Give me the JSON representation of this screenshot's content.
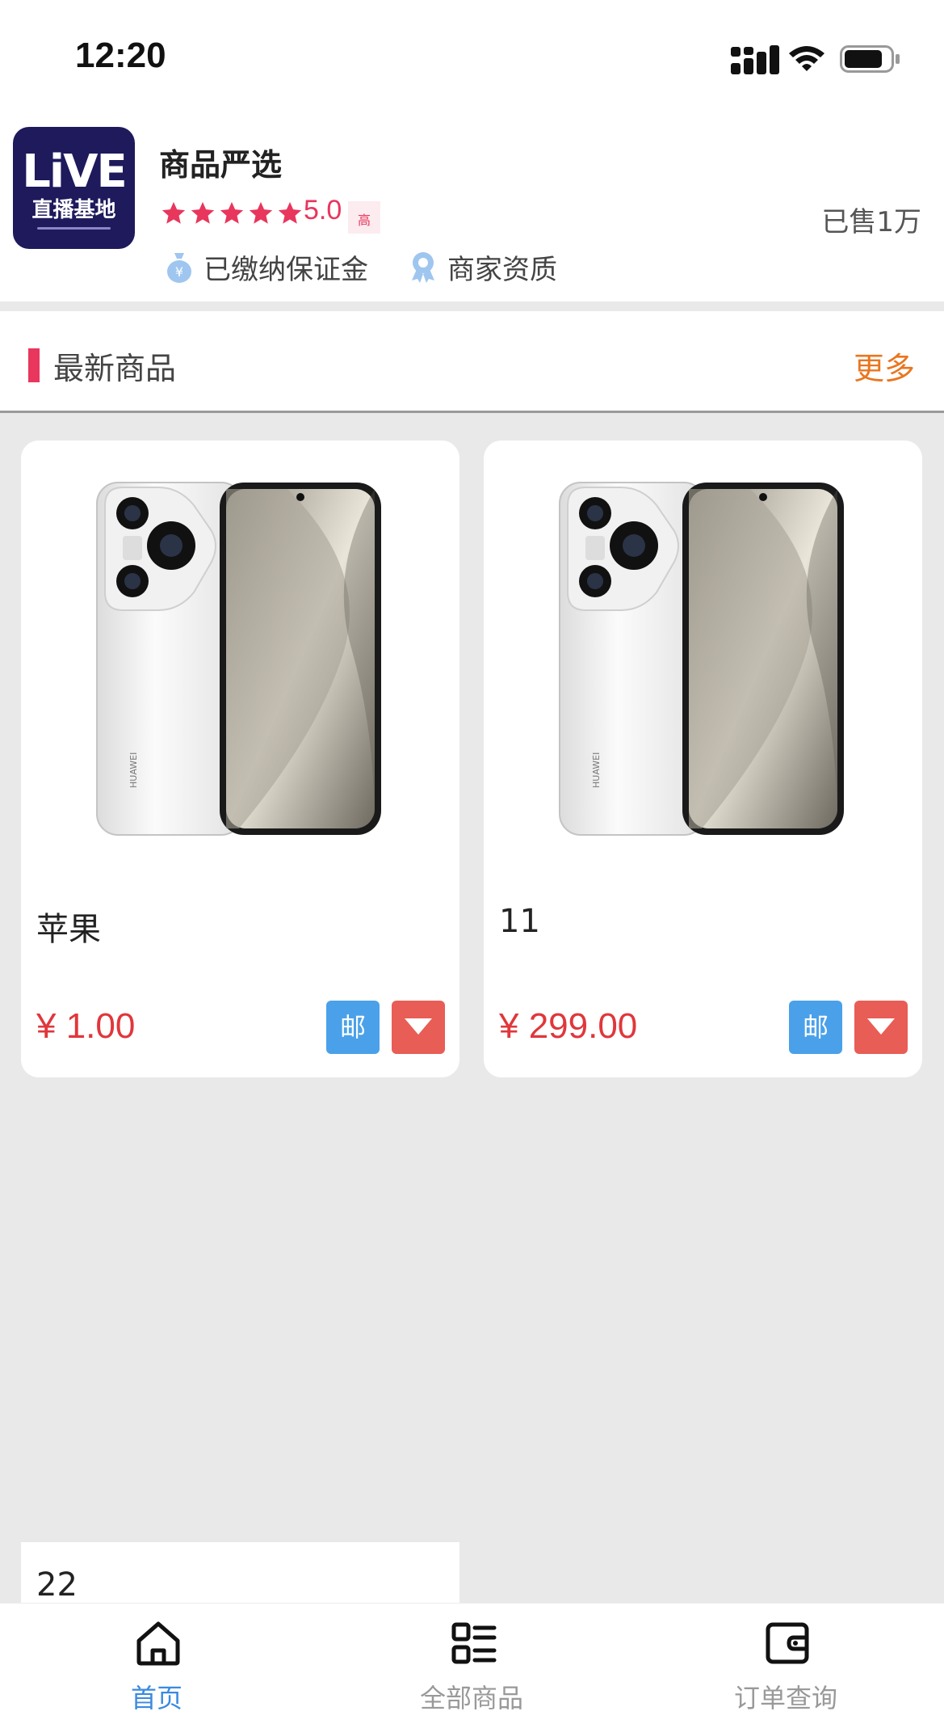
{
  "status_bar": {
    "time": "12:20",
    "icons": [
      "signal-icon",
      "wifi-icon",
      "battery-icon"
    ]
  },
  "shop": {
    "logo_text": "LiVE",
    "logo_subtext": "直播基地",
    "name": "商品严选",
    "stars": 5,
    "rating": "5.0",
    "rating_tag": "高",
    "sold": "已售1万",
    "badges": [
      {
        "icon": "money-bag-icon",
        "label": "已缴纳保证金"
      },
      {
        "icon": "award-ribbon-icon",
        "label": "商家资质"
      }
    ]
  },
  "section": {
    "title": "最新商品",
    "more": "更多"
  },
  "products": [
    {
      "name": "苹果",
      "price": "¥ 1.00",
      "mail_label": "邮",
      "image": "phone-product-image"
    },
    {
      "name": "11",
      "price": "¥ 299.00",
      "mail_label": "邮",
      "image": "phone-product-image"
    },
    {
      "name": "22"
    }
  ],
  "tabbar": {
    "items": [
      {
        "label": "首页",
        "icon": "home-icon",
        "active": true
      },
      {
        "label": "全部商品",
        "icon": "list-grid-icon",
        "active": false
      },
      {
        "label": "订单查询",
        "icon": "wallet-icon",
        "active": false
      }
    ]
  },
  "colors": {
    "accent_pink": "#e8365d",
    "more_orange": "#e9761f",
    "price_red": "#e0373b",
    "mail_blue": "#4aa1ea",
    "dropdown_red": "#e85d55",
    "active_tab_blue": "#3b8ae0"
  }
}
